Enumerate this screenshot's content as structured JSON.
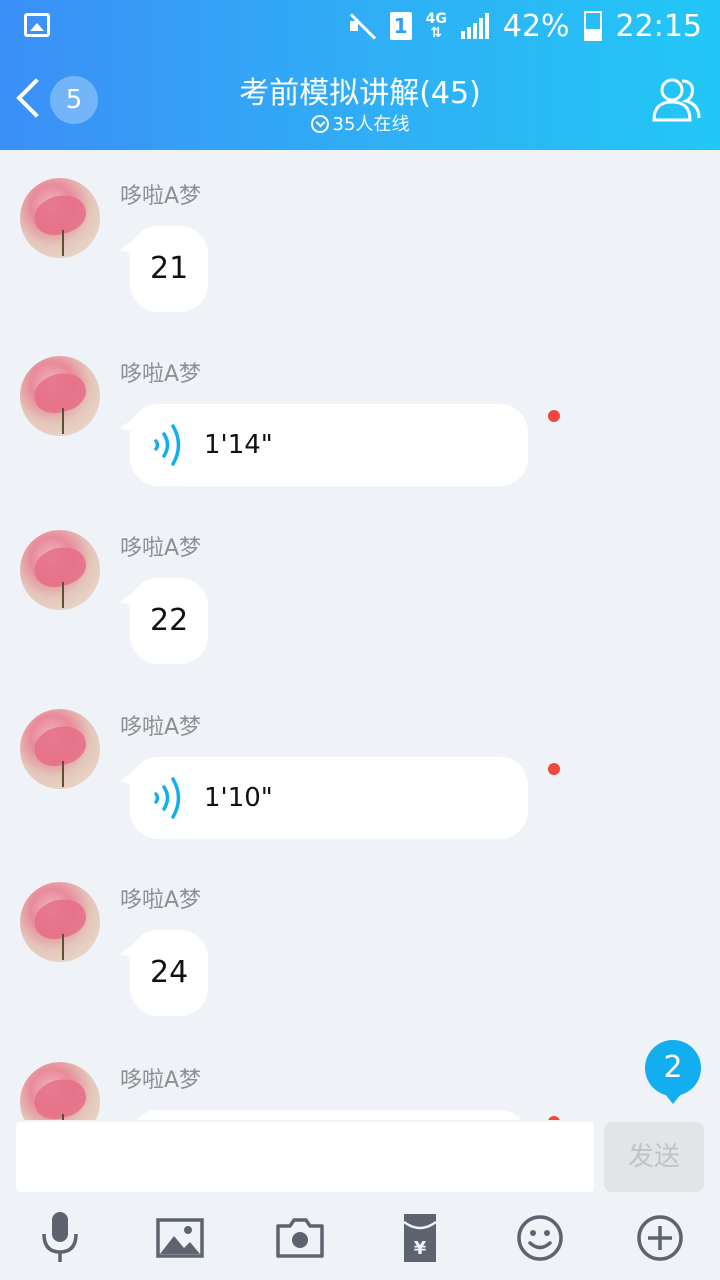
{
  "status_bar": {
    "sim": "1",
    "network": "4G",
    "battery": "42%",
    "time": "22:15"
  },
  "header": {
    "back_count": "5",
    "title": "考前模拟讲解(45)",
    "online": "35人在线"
  },
  "messages": [
    {
      "sender": "哆啦A梦",
      "type": "text",
      "content": "21"
    },
    {
      "sender": "哆啦A梦",
      "type": "voice",
      "content": "1'14\"",
      "unread": true
    },
    {
      "sender": "哆啦A梦",
      "type": "text",
      "content": "22"
    },
    {
      "sender": "哆啦A梦",
      "type": "voice",
      "content": "1'10\"",
      "unread": true
    },
    {
      "sender": "哆啦A梦",
      "type": "text",
      "content": "24"
    },
    {
      "sender": "哆啦A梦",
      "type": "voice",
      "content": "",
      "unread": true
    }
  ],
  "new_messages_badge": "2",
  "input": {
    "value": "",
    "send_label": "发送"
  },
  "toolbar": [
    "microphone-icon",
    "image-icon",
    "camera-icon",
    "red-packet-icon",
    "emoji-icon",
    "plus-icon"
  ],
  "colors": {
    "header_start": "#3b8ff6",
    "header_end": "#22c7f6",
    "background": "#eff2f7",
    "voice_icon": "#12aef0",
    "unread_dot": "#f0463c",
    "badge": "#12aef0"
  }
}
